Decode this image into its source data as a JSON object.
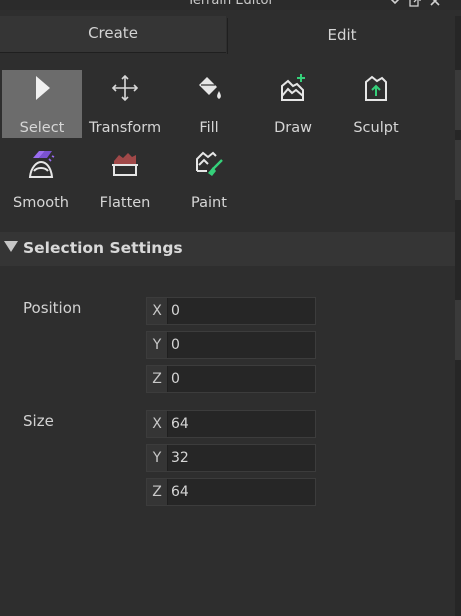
{
  "window": {
    "title": "Terrain Editor"
  },
  "tabs": [
    {
      "label": "Create",
      "active": false
    },
    {
      "label": "Edit",
      "active": true
    }
  ],
  "tools": [
    {
      "label": "Select",
      "icon": "cursor-arrow-icon",
      "selected": true
    },
    {
      "label": "Transform",
      "icon": "move-arrows-icon",
      "selected": false
    },
    {
      "label": "Fill",
      "icon": "paint-bucket-icon",
      "selected": false
    },
    {
      "label": "Draw",
      "icon": "terrain-add-icon",
      "selected": false
    },
    {
      "label": "Sculpt",
      "icon": "terrain-sculpt-icon",
      "selected": false
    },
    {
      "label": "Smooth",
      "icon": "terrain-smooth-icon",
      "selected": false
    },
    {
      "label": "Flatten",
      "icon": "terrain-flatten-icon",
      "selected": false
    },
    {
      "label": "Paint",
      "icon": "terrain-paint-icon",
      "selected": false
    }
  ],
  "section": {
    "title": "Selection Settings",
    "expanded": true
  },
  "position": {
    "label": "Position",
    "fields": [
      {
        "axis": "X",
        "value": "0"
      },
      {
        "axis": "Y",
        "value": "0"
      },
      {
        "axis": "Z",
        "value": "0"
      }
    ]
  },
  "size": {
    "label": "Size",
    "fields": [
      {
        "axis": "X",
        "value": "64"
      },
      {
        "axis": "Y",
        "value": "32"
      },
      {
        "axis": "Z",
        "value": "64"
      }
    ]
  },
  "colors": {
    "background": "#2e2e2e",
    "selected_tool": "#6c6c6c",
    "accent_green": "#35d07a",
    "accent_purple": "#9a6cf0",
    "accent_red": "#a04848"
  }
}
